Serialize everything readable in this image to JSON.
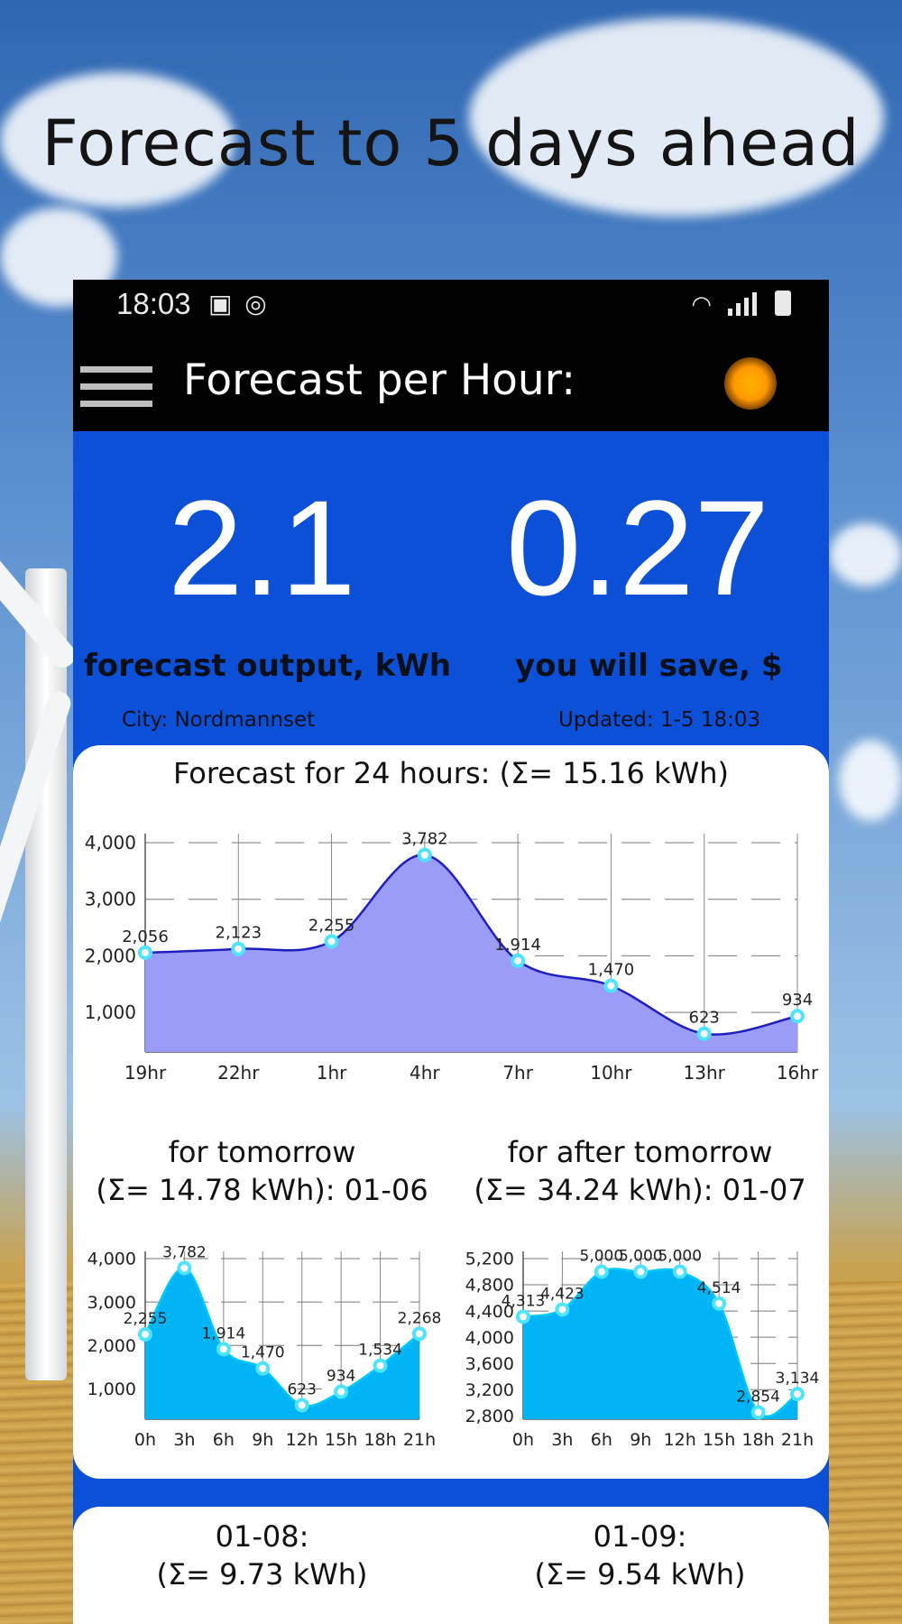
{
  "promo": {
    "title": "Forecast to 5 days ahead"
  },
  "status_bar": {
    "time": "18:03",
    "icons": [
      "image-icon",
      "sync-icon",
      "wifi-icon",
      "signal-icon",
      "battery-icon"
    ]
  },
  "app_bar": {
    "title": "Forecast per Hour:",
    "menu_icon": "hamburger-menu-icon",
    "status_icon": "sun-icon"
  },
  "summary": {
    "output_value": "2.1",
    "output_label": "forecast output, kWh",
    "savings_value": "0.27",
    "savings_label": "you will save, $",
    "city": "City: Nordmannset",
    "updated": "Updated: 1-5 18:03"
  },
  "colors": {
    "header_bg": "#000000",
    "panel_bg": "#0b50d6",
    "main_fill": "#9b9cf8",
    "main_line": "#1f1fbf",
    "small_fill": "#00b4f5",
    "point_stroke": "#4ee3ff"
  },
  "cards": {
    "today_title": "Forecast for 24 hours: (Σ= 15.16 kWh)",
    "tomorrow_title_1": "for tomorrow",
    "tomorrow_title_2": "(Σ= 14.78 kWh): 01-06",
    "after_title_1": "for after tomorrow",
    "after_title_2": "(Σ= 34.24 kWh): 01-07",
    "day4_title_1": "01-08:",
    "day4_title_2": "(Σ= 9.73 kWh)",
    "day5_title_1": "01-09:",
    "day5_title_2": "(Σ= 9.54 kWh)"
  },
  "chart_data": [
    {
      "type": "area",
      "title": "Forecast for 24 hours: (Σ= 15.16 kWh)",
      "categories": [
        "19hr",
        "22hr",
        "1hr",
        "4hr",
        "7hr",
        "10hr",
        "13hr",
        "16hr"
      ],
      "values": [
        2056,
        2123,
        2255,
        3782,
        1914,
        1470,
        623,
        934
      ],
      "data_labels": [
        "2,056",
        "2,123",
        "2,255",
        "3,782",
        "1,914",
        "1,470",
        "623",
        "934"
      ],
      "yticks": [
        "1,000",
        "2,000",
        "3,000",
        "4,000"
      ],
      "ytick_values": [
        1000,
        2000,
        3000,
        4000
      ],
      "ylim": [
        300,
        4000
      ],
      "grid": true
    },
    {
      "type": "area",
      "title": "for tomorrow (Σ= 14.78 kWh): 01-06",
      "categories": [
        "0h",
        "3h",
        "6h",
        "9h",
        "12h",
        "15h",
        "18h",
        "21h"
      ],
      "values": [
        2255,
        3782,
        1914,
        1470,
        623,
        934,
        1534,
        2268
      ],
      "data_labels": [
        "2,255",
        "3,782",
        "1,914",
        "1,470",
        "623",
        "934",
        "1,534",
        "2,268"
      ],
      "yticks": [
        "1,000",
        "2,000",
        "3,000",
        "4,000"
      ],
      "ytick_values": [
        1000,
        2000,
        3000,
        4000
      ],
      "ylim": [
        300,
        4000
      ],
      "grid": true
    },
    {
      "type": "area",
      "title": "for after tomorrow (Σ= 34.24 kWh): 01-07",
      "categories": [
        "0h",
        "3h",
        "6h",
        "9h",
        "12h",
        "15h",
        "18h",
        "21h"
      ],
      "values": [
        4313,
        4423,
        5000,
        5000,
        5000,
        4514,
        2854,
        3134
      ],
      "data_labels": [
        "4,313",
        "4,423",
        "5,000",
        "5,000",
        "5,000",
        "4,514",
        "2,854",
        "3,134"
      ],
      "yticks": [
        "2,800",
        "3,200",
        "3,600",
        "4,000",
        "4,400",
        "4,800",
        "5,200"
      ],
      "ytick_values": [
        2800,
        3200,
        3600,
        4000,
        4400,
        4800,
        5200
      ],
      "ylim": [
        2750,
        5200
      ],
      "grid": true
    }
  ]
}
